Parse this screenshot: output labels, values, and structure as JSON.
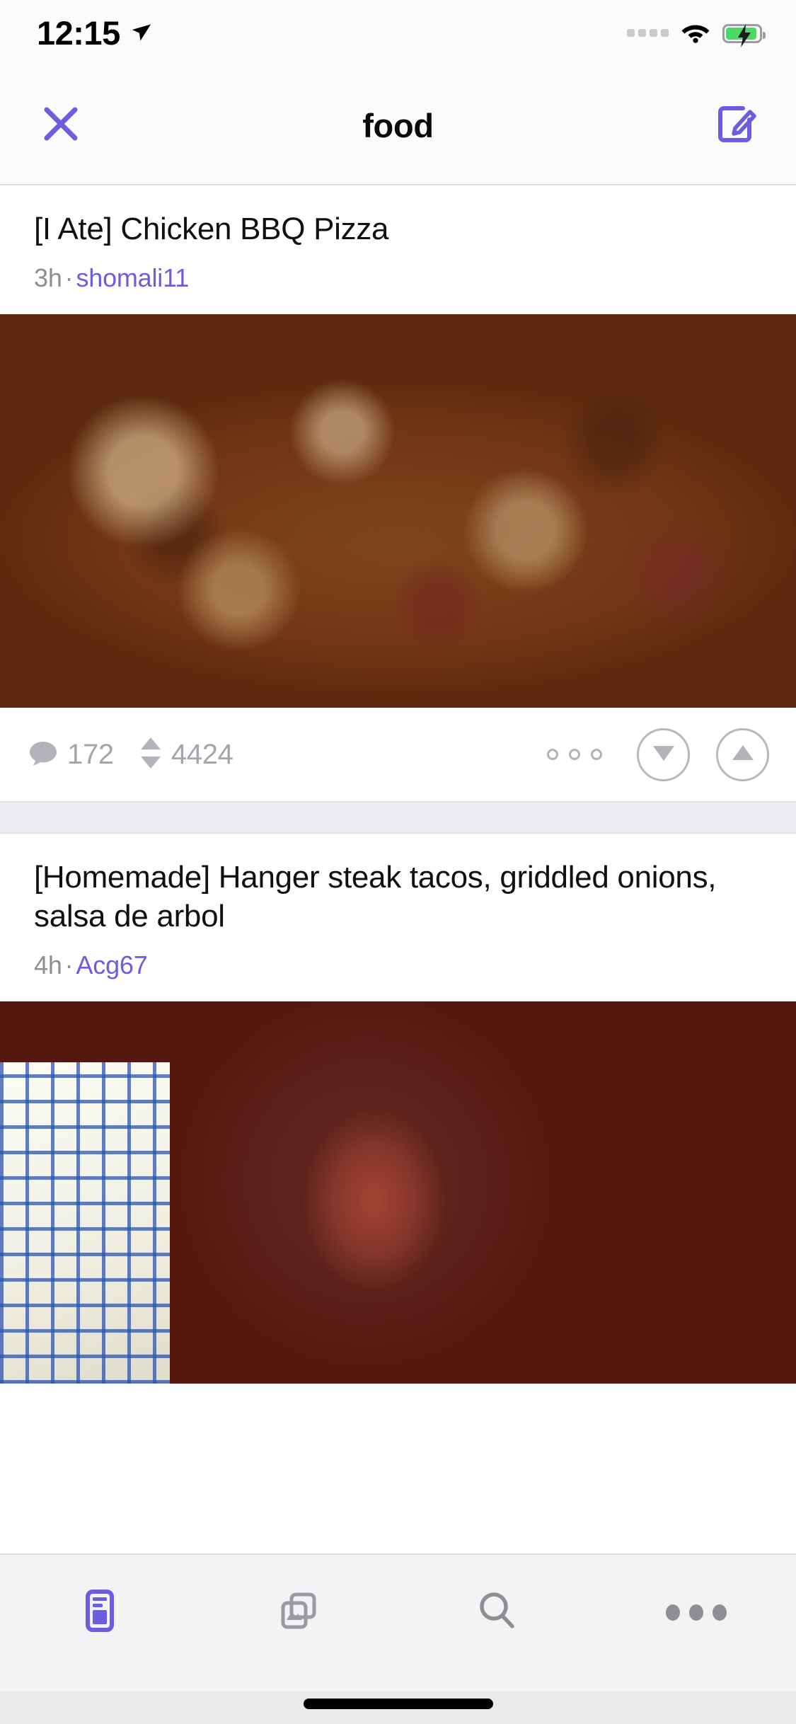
{
  "status_bar": {
    "time": "12:15",
    "location_icon": "location-arrow-icon",
    "signal_icon": "signal-dots-icon",
    "wifi_icon": "wifi-icon",
    "battery_icon": "battery-charging-icon",
    "battery_color": "#4cd964"
  },
  "nav_bar": {
    "close_icon": "close-x-icon",
    "title": "food",
    "compose_icon": "compose-pencil-icon",
    "accent_color": "#6b5ce0"
  },
  "posts": [
    {
      "title": "[I Ate] Chicken BBQ Pizza",
      "age": "3h",
      "separator": "·",
      "author": "shomali11",
      "image_alt": "bbq-chicken-pizza-photo",
      "comment_icon": "comment-bubble-icon",
      "comments": "172",
      "vote_icon": "vote-arrows-icon",
      "score": "4424",
      "more_icon": "more-options-icon",
      "downvote_icon": "downvote-arrow-icon",
      "upvote_icon": "upvote-arrow-icon"
    },
    {
      "title": "[Homemade] Hanger steak tacos, griddled onions, salsa de arbol",
      "age": "4h",
      "separator": "·",
      "author": "Acg67",
      "image_alt": "hanger-steak-tacos-photo"
    }
  ],
  "tab_bar": {
    "tabs": [
      {
        "name": "feed",
        "icon": "feed-card-icon",
        "active": true
      },
      {
        "name": "gallery",
        "icon": "gallery-stack-icon",
        "active": false
      },
      {
        "name": "search",
        "icon": "search-magnifier-icon",
        "active": false
      },
      {
        "name": "more",
        "icon": "more-dots-icon",
        "active": false
      }
    ],
    "active_color": "#6b5ce0",
    "inactive_color": "#8e8e93"
  },
  "home_indicator": "home-indicator-bar"
}
